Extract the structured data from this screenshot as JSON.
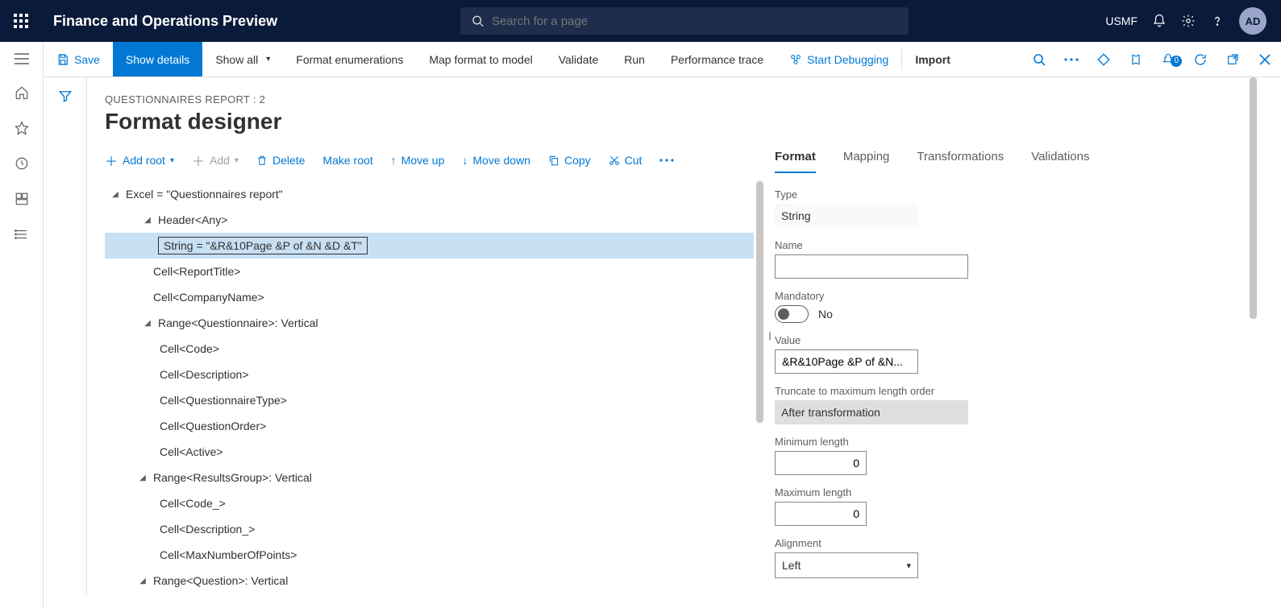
{
  "topbar": {
    "app_title": "Finance and Operations Preview",
    "search_placeholder": "Search for a page",
    "company": "USMF",
    "avatar": "AD"
  },
  "actionbar": {
    "save": "Save",
    "show_details": "Show details",
    "show_all": "Show all",
    "format_enum": "Format enumerations",
    "map_format": "Map format to model",
    "validate": "Validate",
    "run": "Run",
    "perf_trace": "Performance trace",
    "start_debug": "Start Debugging",
    "import": "Import",
    "badge_count": "0"
  },
  "page": {
    "breadcrumb": "QUESTIONNAIRES REPORT : 2",
    "title": "Format designer"
  },
  "tree_toolbar": {
    "add_root": "Add root",
    "add": "Add",
    "delete": "Delete",
    "make_root": "Make root",
    "move_up": "Move up",
    "move_down": "Move down",
    "copy": "Copy",
    "cut": "Cut"
  },
  "tree": {
    "n0": "Excel = \"Questionnaires report\"",
    "n1": "Header<Any>",
    "n1a": "String = \"&R&10Page &P of &N &D &T\"",
    "n1b": "Cell<ReportTitle>",
    "n1c": "Cell<CompanyName>",
    "n2": "Range<Questionnaire>: Vertical",
    "n2a": "Cell<Code>",
    "n2b": "Cell<Description>",
    "n2c": "Cell<QuestionnaireType>",
    "n2d": "Cell<QuestionOrder>",
    "n2e": "Cell<Active>",
    "n3": "Range<ResultsGroup>: Vertical",
    "n3a": "Cell<Code_>",
    "n3b": "Cell<Description_>",
    "n3c": "Cell<MaxNumberOfPoints>",
    "n4": "Range<Question>: Vertical"
  },
  "tabs": {
    "format": "Format",
    "mapping": "Mapping",
    "transformations": "Transformations",
    "validations": "Validations"
  },
  "form": {
    "type_label": "Type",
    "type_value": "String",
    "name_label": "Name",
    "name_value": "",
    "mandatory_label": "Mandatory",
    "mandatory_value": "No",
    "value_label": "Value",
    "value_value": "&R&10Page &P of &N...",
    "truncate_label": "Truncate to maximum length order",
    "truncate_value": "After transformation",
    "minlen_label": "Minimum length",
    "minlen_value": "0",
    "maxlen_label": "Maximum length",
    "maxlen_value": "0",
    "align_label": "Alignment",
    "align_value": "Left"
  }
}
